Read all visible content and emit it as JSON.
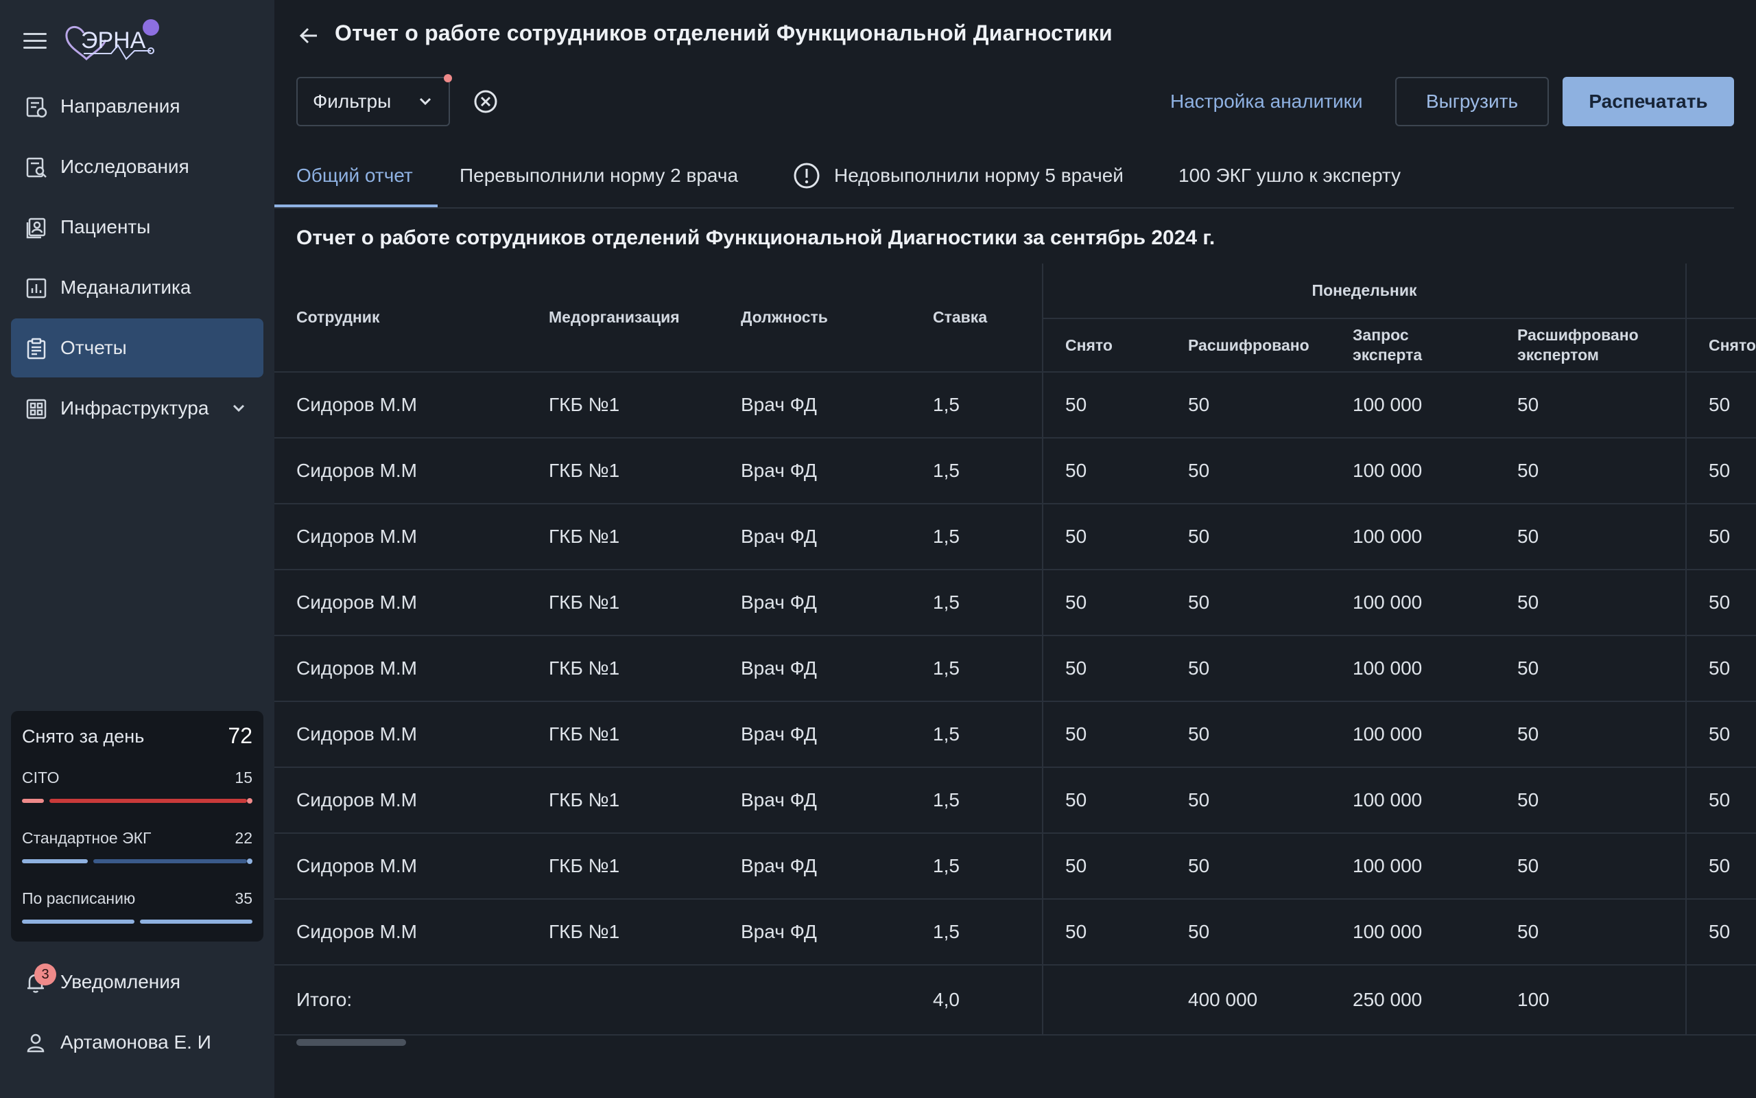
{
  "sidebar": {
    "logo_text": "ЭРНА",
    "nav": [
      {
        "label": "Направления",
        "icon": "referral-icon"
      },
      {
        "label": "Исследования",
        "icon": "research-icon"
      },
      {
        "label": "Пациенты",
        "icon": "patients-icon"
      },
      {
        "label": "Меданалитика",
        "icon": "analytics-icon"
      },
      {
        "label": "Отчеты",
        "icon": "reports-icon",
        "active": true
      },
      {
        "label": "Инфраструктура",
        "icon": "grid-icon"
      }
    ],
    "stats": {
      "title": "Снято за день",
      "total": "72",
      "rows": [
        {
          "label": "CITO",
          "value": "15",
          "color": "#c93a3a",
          "accent": "#ef8a8a"
        },
        {
          "label": "Стандартное ЭКГ",
          "value": "22",
          "color": "#3a5a8a",
          "accent": "#8eb1e0"
        },
        {
          "label": "По расписанию",
          "value": "35",
          "color": "#8eb1e0",
          "accent": "#8eb1e0"
        }
      ]
    },
    "notifications": {
      "label": "Уведомления",
      "count": "3"
    },
    "user": {
      "label": "Артамонова Е. И"
    }
  },
  "header": {
    "title": "Отчет о работе сотрудников отделений Функциональной Диагностики",
    "filters_label": "Фильтры",
    "analytics_settings": "Настройка аналитики",
    "export": "Выгрузить",
    "print": "Распечатать"
  },
  "tabs": [
    {
      "label": "Общий отчет",
      "active": true
    },
    {
      "label": "Перевыполнили норму 2 врача"
    },
    {
      "label": "Недовыполнили норму 5 врачей",
      "icon": "warning-icon"
    },
    {
      "label": "100 ЭКГ ушло к эксперту"
    }
  ],
  "report": {
    "title": "Отчет о работе сотрудников отделений Функциональной Диагностики за сентябрь 2024 г.",
    "columns": {
      "employee": "Сотрудник",
      "org": "Медорганизация",
      "position": "Должность",
      "rate": "Ставка",
      "group": "Понедельник",
      "taken": "Снято",
      "decoded": "Расшифровано",
      "expert_request": "Запрос эксперта",
      "decoded_by_expert": "Расшифровано экспертом",
      "taken_next": "Снято"
    },
    "rows": [
      [
        "Сидоров М.М",
        "ГКБ №1",
        "Врач ФД",
        "1,5",
        "50",
        "50",
        "100 000",
        "50",
        "50"
      ],
      [
        "Сидоров М.М",
        "ГКБ №1",
        "Врач ФД",
        "1,5",
        "50",
        "50",
        "100 000",
        "50",
        "50"
      ],
      [
        "Сидоров М.М",
        "ГКБ №1",
        "Врач ФД",
        "1,5",
        "50",
        "50",
        "100 000",
        "50",
        "50"
      ],
      [
        "Сидоров М.М",
        "ГКБ №1",
        "Врач ФД",
        "1,5",
        "50",
        "50",
        "100 000",
        "50",
        "50"
      ],
      [
        "Сидоров М.М",
        "ГКБ №1",
        "Врач ФД",
        "1,5",
        "50",
        "50",
        "100 000",
        "50",
        "50"
      ],
      [
        "Сидоров М.М",
        "ГКБ №1",
        "Врач ФД",
        "1,5",
        "50",
        "50",
        "100 000",
        "50",
        "50"
      ],
      [
        "Сидоров М.М",
        "ГКБ №1",
        "Врач ФД",
        "1,5",
        "50",
        "50",
        "100 000",
        "50",
        "50"
      ],
      [
        "Сидоров М.М",
        "ГКБ №1",
        "Врач ФД",
        "1,5",
        "50",
        "50",
        "100 000",
        "50",
        "50"
      ],
      [
        "Сидоров М.М",
        "ГКБ №1",
        "Врач ФД",
        "1,5",
        "50",
        "50",
        "100 000",
        "50",
        "50"
      ]
    ],
    "total": {
      "label": "Итого:",
      "rate": "4,0",
      "taken": "",
      "decoded": "400 000",
      "expert_request": "250 000",
      "decoded_by_expert": "100",
      "taken_next": ""
    }
  }
}
